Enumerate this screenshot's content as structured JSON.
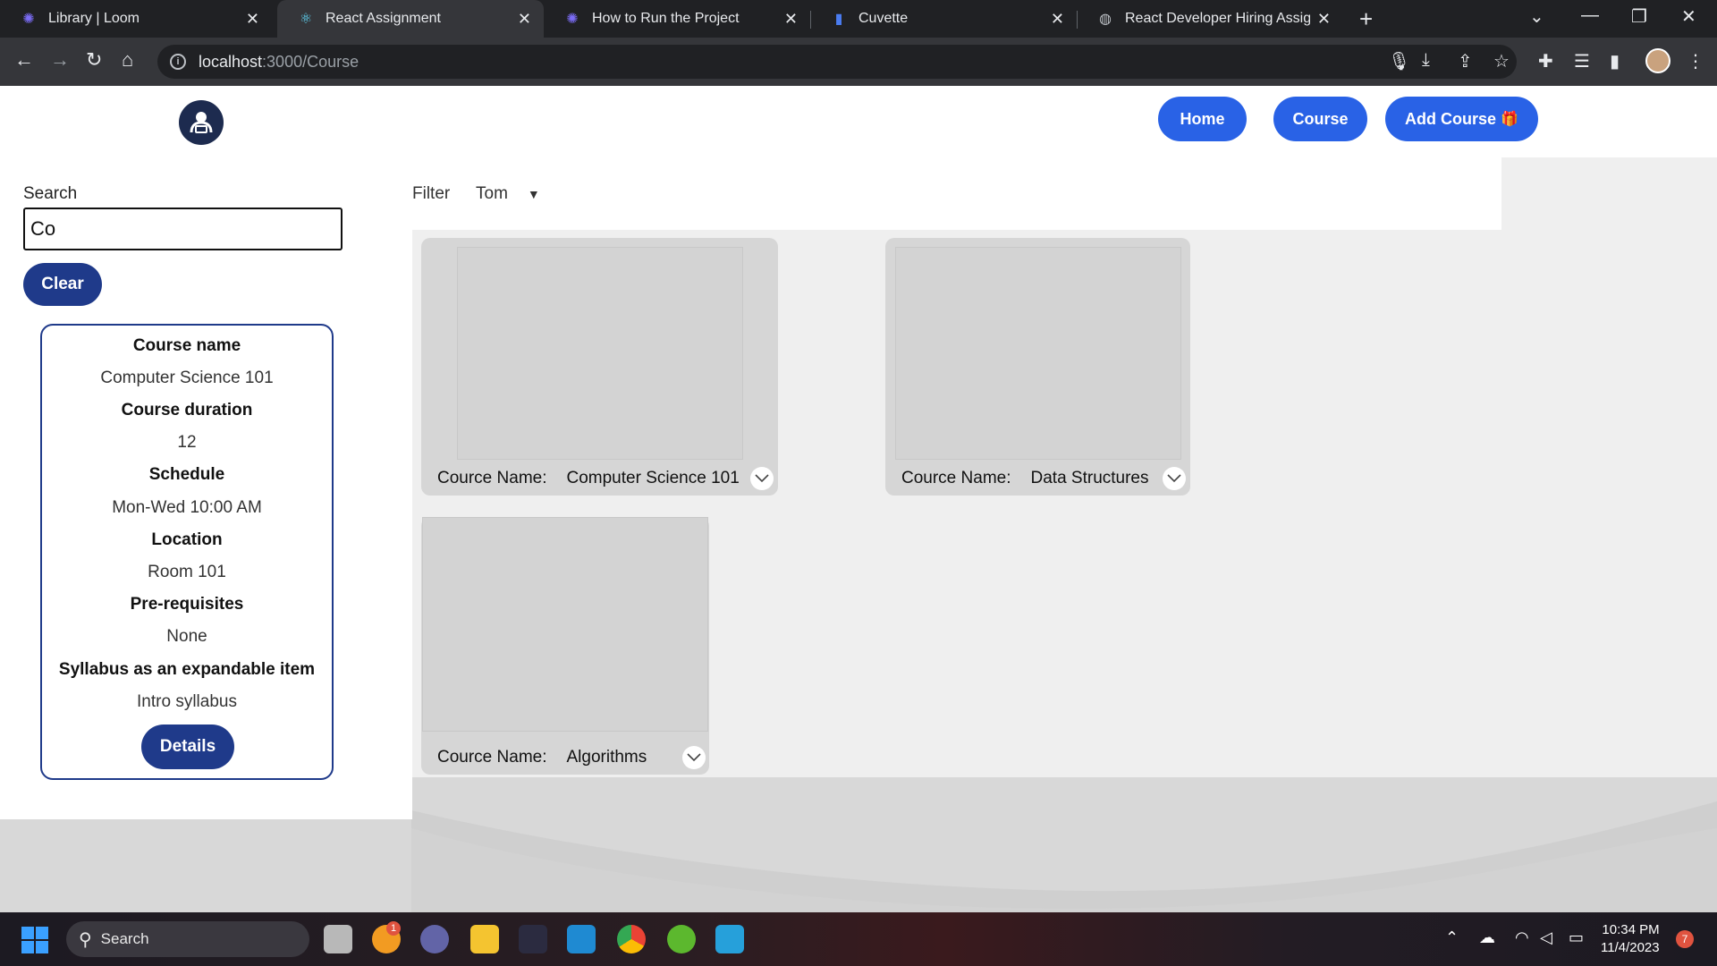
{
  "browser": {
    "tabs": [
      {
        "title": "Library | Loom",
        "icon": "loom-icon",
        "active": false
      },
      {
        "title": "React Assignment",
        "icon": "react-icon",
        "active": true
      },
      {
        "title": "How to Run the Project",
        "icon": "loom-icon",
        "active": false
      },
      {
        "title": "Cuvette",
        "icon": "cuvette-icon",
        "active": false
      },
      {
        "title": "React Developer Hiring Assignm",
        "icon": "globe-icon",
        "active": false
      }
    ],
    "url_host": "localhost",
    "url_path": ":3000/Course"
  },
  "nav": {
    "home": "Home",
    "course": "Course",
    "add_course": "Add Course",
    "add_course_emoji": "🎁"
  },
  "sidebar": {
    "search_label": "Search",
    "search_value": "Co",
    "clear_label": "Clear",
    "detail": {
      "rows": [
        {
          "label": "Course name",
          "value": "Computer Science 101"
        },
        {
          "label": "Course duration",
          "value": "12"
        },
        {
          "label": "Schedule",
          "value": "Mon-Wed 10:00 AM"
        },
        {
          "label": "Location",
          "value": "Room 101"
        },
        {
          "label": "Pre-requisites",
          "value": "None"
        },
        {
          "label": "Syllabus as an expandable item",
          "value": "Intro syllabus"
        }
      ],
      "details_button": "Details"
    }
  },
  "filter": {
    "label": "Filter",
    "selected": "Tom"
  },
  "courses": [
    {
      "caption_label": "Cource Name:",
      "name": "Computer Science 101"
    },
    {
      "caption_label": "Cource Name:",
      "name": "Data Structures"
    },
    {
      "caption_label": "Cource Name:",
      "name": "Algorithms"
    }
  ],
  "taskbar": {
    "search_placeholder": "Search",
    "time": "10:34 PM",
    "date": "11/4/2023",
    "notification_count": "7",
    "app_badge": "1"
  }
}
